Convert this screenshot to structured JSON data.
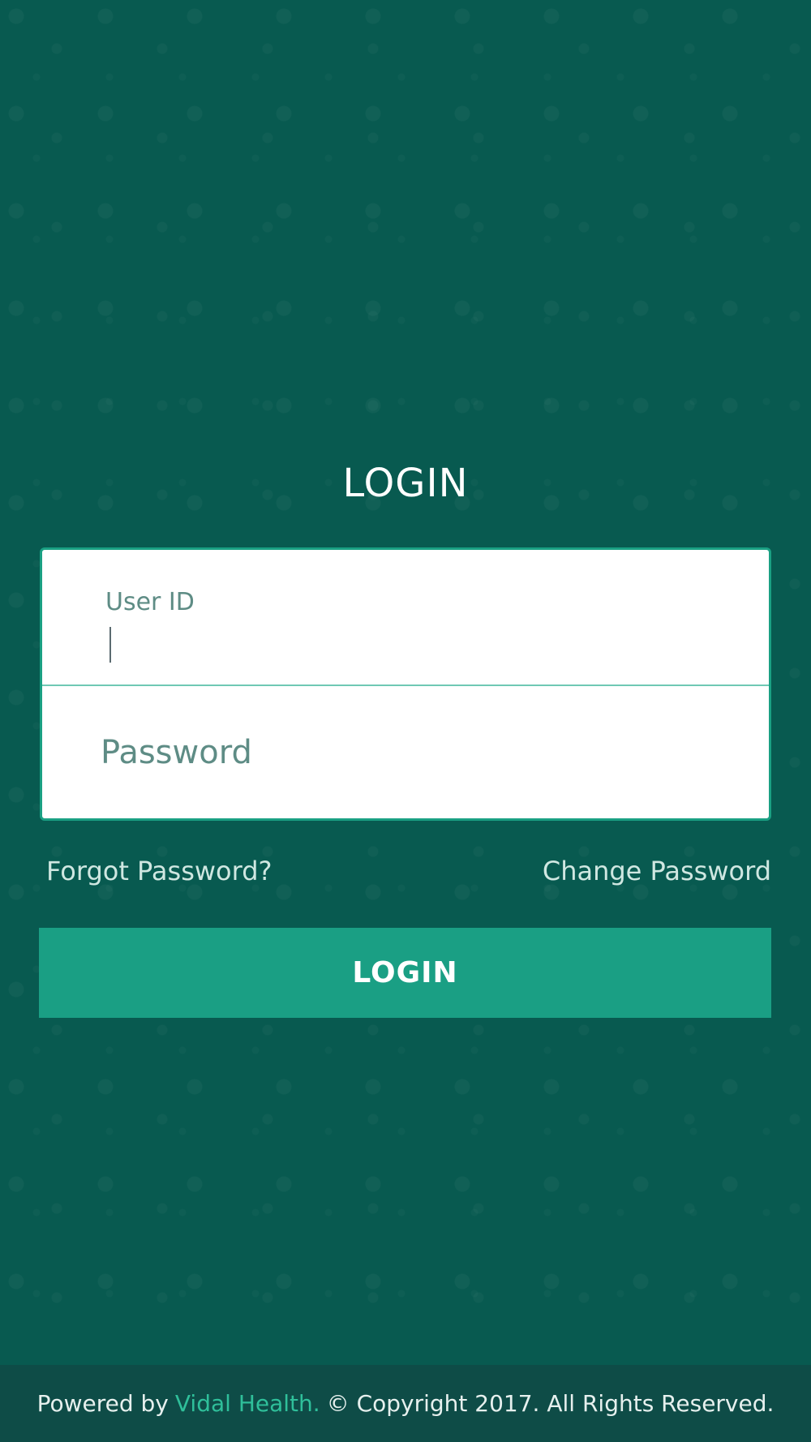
{
  "page": {
    "title": "LOGIN"
  },
  "form": {
    "userid_label": "User ID",
    "userid_value": "",
    "password_placeholder": "Password",
    "password_value": ""
  },
  "links": {
    "forgot_password": "Forgot Password?",
    "change_password": "Change Password"
  },
  "actions": {
    "login_label": "LOGIN"
  },
  "footer": {
    "powered_by": "Powered by",
    "brand": "Vidal Health.",
    "copyright": "© Copyright 2017. All Rights Reserved."
  },
  "colors": {
    "background": "#085a50",
    "accent": "#1a9f84",
    "brand": "#2fbf9a",
    "footer_bg": "#0e4c47"
  }
}
